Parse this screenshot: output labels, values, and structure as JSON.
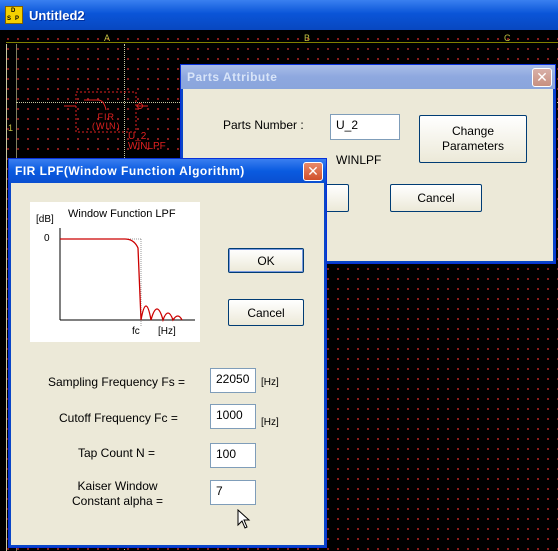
{
  "app": {
    "title": "Untitled2",
    "icon_letters": [
      "D",
      "S",
      "P"
    ]
  },
  "canvas": {
    "columns": [
      "A",
      "B",
      "C"
    ],
    "rows": [
      "1"
    ],
    "part": {
      "name_lines": [
        "FIR",
        "(WIN)"
      ],
      "ref": "U_2",
      "type": "WINLPF"
    }
  },
  "parts_dialog": {
    "title": "Parts Attribute",
    "parts_number_label": "Parts Number :",
    "parts_number_value": "U_2",
    "part_type": "WINLPF",
    "change_params_label": "Change\nParameters",
    "cancel_label": "Cancel"
  },
  "fir_dialog": {
    "title": "FIR LPF(Window Function Algorithm)",
    "graph": {
      "title": "Window Function LPF",
      "y_unit": "[dB]",
      "y_zero": "0",
      "x_cutoff": "fc",
      "x_unit": "[Hz]"
    },
    "ok_label": "OK",
    "cancel_label": "Cancel",
    "fields": [
      {
        "label": "Sampling Frequency Fs =",
        "value": "22050",
        "unit": "[Hz]"
      },
      {
        "label": "Cutoff Frequency Fc =",
        "value": "1000",
        "unit": "[Hz]"
      },
      {
        "label": "Tap Count N =",
        "value": "100",
        "unit": ""
      },
      {
        "label": "Kaiser Window\nConstant alpha =",
        "value": "7",
        "unit": ""
      }
    ]
  },
  "colors": {
    "titlebar": "#0a55d8",
    "dialog_bg": "#ece9d8",
    "grid_dot": "#a02020",
    "part_red": "#e02020",
    "curve_red": "#cc0000"
  }
}
